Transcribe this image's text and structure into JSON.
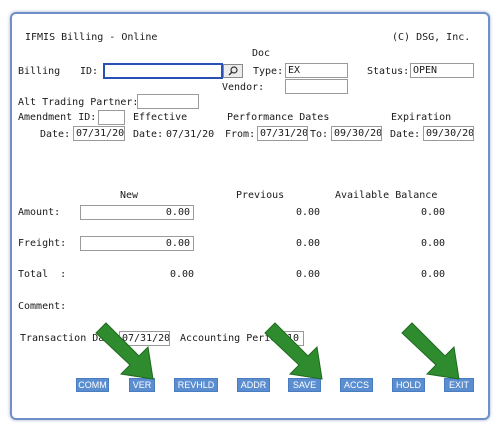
{
  "header": {
    "title": "IFMIS Billing - Online",
    "copyright": "(C) DSG, Inc."
  },
  "billing": {
    "section_label": "Billing",
    "id_label": "ID:",
    "id_value": "",
    "doc_label": "Doc",
    "type_label": "Type:",
    "type_value": "EX",
    "vendor_label": "Vendor:",
    "vendor_value": "",
    "status_label": "Status:",
    "status_value": "OPEN",
    "alt_trading_label": "Alt Trading Partner:",
    "alt_trading_value": ""
  },
  "amendment": {
    "id_label": "Amendment ID:",
    "id_value": "",
    "date_label": "Date:",
    "date_value": "07/31/20"
  },
  "effective": {
    "label": "Effective",
    "date_label": "Date:",
    "date_value": "07/31/20"
  },
  "performance": {
    "label": "Performance Dates",
    "from_label": "From:",
    "from_value": "07/31/20",
    "to_label": "To:",
    "to_value": "09/30/20"
  },
  "expiration": {
    "label": "Expiration",
    "date_label": "Date:",
    "date_value": "09/30/20"
  },
  "amounts": {
    "col_new": "New",
    "col_previous": "Previous",
    "col_available": "Available Balance",
    "rows": [
      {
        "label": "Amount:",
        "new": "0.00",
        "previous": "0.00",
        "available": "0.00"
      },
      {
        "label": "Freight:",
        "new": "0.00",
        "previous": "0.00",
        "available": "0.00"
      },
      {
        "label": "Total  :",
        "new": "0.00",
        "previous": "0.00",
        "available": "0.00"
      }
    ]
  },
  "comment_label": "Comment:",
  "transaction": {
    "label": "Transaction Date:",
    "value": "07/31/20",
    "accounting_label": "Accounting Period:",
    "accounting_value": "10"
  },
  "buttons": [
    "COMM",
    "VER",
    "REVHLD",
    "ADDR",
    "SAVE",
    "ACCS",
    "HOLD",
    "EXIT"
  ],
  "colors": {
    "frame": "#6f8fc8",
    "button": "#5b8ed0",
    "arrow": "#2e8b2e",
    "focus_border": "#2a4fb5"
  },
  "icons": {
    "lookup": "magnifier-icon",
    "annotation": "green-arrow-icon"
  }
}
